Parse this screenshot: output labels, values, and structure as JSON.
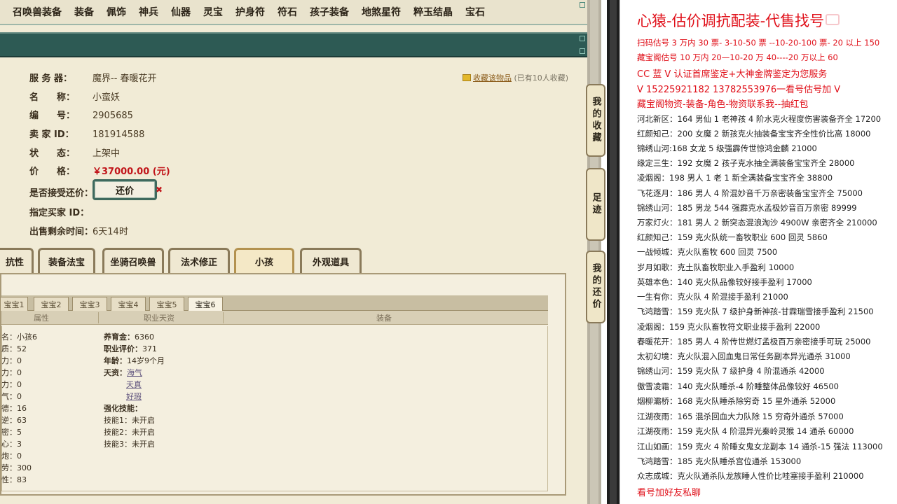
{
  "nav": [
    "召唤兽装备",
    "装备",
    "佩饰",
    "神兵",
    "仙器",
    "灵宝",
    "护身符",
    "符石",
    "孩子装备",
    "地煞星符",
    "粹玉结晶",
    "宝石"
  ],
  "listing": {
    "server_label": "服 务 器：",
    "server_value": "魔界-- 春暖花开",
    "name_label": "名　　称：",
    "name_value": "小蛮妖",
    "id_label": "编　　号：",
    "id_value": "2905685",
    "seller_label": "卖 家 ID：",
    "seller_value": "181914588",
    "status_label": "状　　态：",
    "status_value": "上架中",
    "price_label": "价　　格：",
    "price_value": "￥37000.00 (元)",
    "haggle_label": "是否接受还价：",
    "haggle_button": "还价",
    "buyer_label": "指定买家 ID：",
    "time_label": "出售剩余时间：",
    "time_value": "6天14时",
    "fav_link": "收藏该物品",
    "fav_count": "(已有10人收藏)"
  },
  "tabs": [
    "抗性",
    "装备法宝",
    "坐骑召唤兽",
    "法术修正",
    "小孩",
    "外观道具"
  ],
  "active_tab": "小孩",
  "sub_tabs": [
    "宝宝1",
    "宝宝2",
    "宝宝3",
    "宝宝4",
    "宝宝5",
    "宝宝6"
  ],
  "active_sub_tab": "宝宝6",
  "table_headers": [
    "属性",
    "职业天资",
    "装备"
  ],
  "col1": [
    "名：小孩6",
    "质：52",
    "力：0",
    "力：0",
    "力：0",
    "气：0",
    "德：16",
    "逆：63",
    "密：5",
    "心：3",
    "炮：0",
    "劳：300",
    "性：83"
  ],
  "col2": {
    "yuer_k": "养育金：",
    "yuer_v": "6360",
    "pingjia_k": "职业评价：",
    "pingjia_v": "371",
    "age_k": "年龄：",
    "age_v": "14岁9个月",
    "tianzi_k": "天资：",
    "tianzi": [
      "海气",
      "天真",
      "好瑕"
    ],
    "qiang_k": "强化技能：",
    "skills": [
      "技能1：未开启",
      "技能2：未开启",
      "技能3：未开启"
    ]
  },
  "side_tabs": [
    "我的收藏",
    "足迹",
    "我的还价"
  ],
  "right": {
    "title": "心猿-估价调抗配装-代售找号",
    "red_lines": [
      "扫码估号 3 万内 30 票- 3-10-50 票  --10-20-100 票- 20 以上 150",
      "藏宝阁估号 10 万内 20—10-20 万 40----20 万以上 60",
      "CC 蓝 V 认证首席鉴定+大神金牌鉴定为您服务",
      "V 15225921182      13782553976一看号估号加 V",
      "藏宝阁物资-装备-角色-物资联系我--抽红包"
    ],
    "lines": [
      "河北新区：164 男仙 1 老神孩 4 阶水克火程度伤害装备齐全 17200",
      "红颜知己：200 女魔 2 新孩克火抽装备宝宝齐全性价比高 18000",
      "锦绣山河:168 女龙 5 级强霹传世惊鸿金麟 21000",
      "缘定三生：192 女魔 2 孩子克水抽全满装备宝宝齐全 28000",
      "凌烟阁：198 男人 1 老 1 新全满装备宝宝齐全 38800",
      "飞花逐月：186 男人 4 阶混妙音千万亲密装备宝宝齐全 75000",
      "锦绣山河：185 男龙 544 强霹克水孟极妙音百万亲密 89999",
      "万家灯火：181 男人 2 新突态混浪淘沙 4900W 亲密齐全 210000",
      "红颜知己：159 克火队统一畜牧职业 600 回灵 5860",
      "一战倾城：克火队畜牧 600 回灵 7500",
      "岁月如歌：克土队畜牧职业入手盈利 10000",
      "英雄本色：140 克火队品像较好接手盈利 17000",
      "一生有你：克火队 4 阶混接手盈利 21000",
      "飞鸿踏雪：159 克火队 7 级护身新神孩-甘霖瑞雪接手盈利 21500",
      "凌烟阁：159 克火队畜牧符文职业接手盈利 22000",
      "春暖花开：185 男人 4 阶传世燃灯孟极百万亲密接手可玩 25000",
      "太初幻境：克火队混入回血鬼日常任务副本异光通杀 31000",
      "锦绣山河：159 克火队 7 级护身 4 阶混通杀 42000",
      "傲雪凌霜：140 克火队睡杀-4 阶睡整体品像较好 46500",
      "烟柳灞桥：168 克火队睡杀除穷奇 15 星外通杀 52000",
      "江湖夜雨：165 混杀回血大力队除 15 穷奇外通杀 57000",
      "江湖夜雨：159 克火队 4 阶混异光秦岭灵猴 14 通杀 60000",
      "江山如画：159 克火 4 阶睡女鬼女龙副本 14 通杀-15 强法 113000",
      "飞鸿踏雪：185 克火队睡杀宫位通杀 153000",
      "众志成城：克火队通杀队龙族睡人性价比哇塞接手盈利 210000"
    ],
    "bottom": "看号加好友私聊"
  }
}
